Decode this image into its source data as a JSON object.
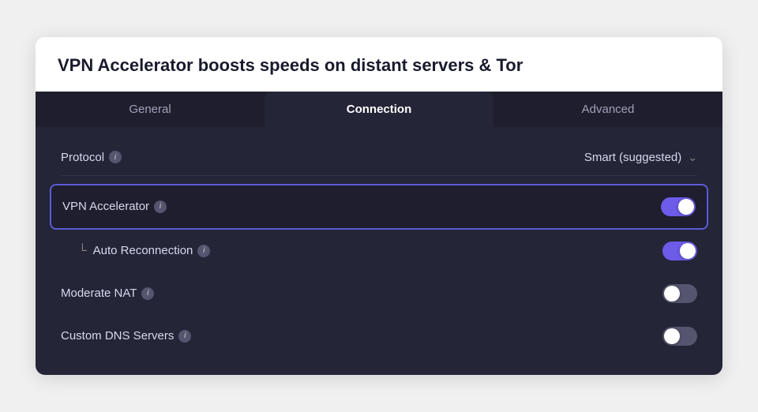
{
  "header": {
    "title": "VPN Accelerator boosts speeds on distant servers & Tor"
  },
  "tabs": [
    {
      "id": "general",
      "label": "General",
      "active": false
    },
    {
      "id": "connection",
      "label": "Connection",
      "active": true
    },
    {
      "id": "advanced",
      "label": "Advanced",
      "active": false
    }
  ],
  "protocol": {
    "label": "Protocol",
    "value": "Smart (suggested)"
  },
  "settings": [
    {
      "id": "vpn-accelerator",
      "label": "VPN Accelerator",
      "highlighted": true,
      "sub": false,
      "enabled": true
    },
    {
      "id": "auto-reconnection",
      "label": "Auto Reconnection",
      "highlighted": false,
      "sub": true,
      "enabled": true
    },
    {
      "id": "moderate-nat",
      "label": "Moderate NAT",
      "highlighted": false,
      "sub": false,
      "enabled": false
    },
    {
      "id": "custom-dns",
      "label": "Custom DNS Servers",
      "highlighted": false,
      "sub": false,
      "enabled": false
    }
  ],
  "icons": {
    "info": "i",
    "chevron_down": "⌄"
  }
}
